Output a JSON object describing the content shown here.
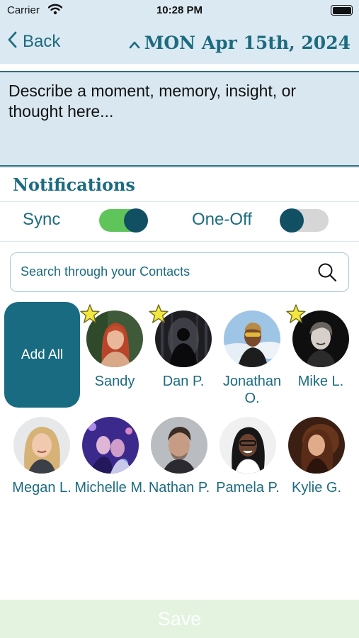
{
  "status_bar": {
    "carrier": "Carrier",
    "time": "10:28 PM",
    "battery_percent": 100
  },
  "nav": {
    "back_label": "Back",
    "date_label": "MON Apr 15th, 2024"
  },
  "note": {
    "placeholder": "Describe a moment, memory, insight, or thought here..."
  },
  "notifications": {
    "title": "Notifications",
    "sync_label": "Sync",
    "sync_on": true,
    "oneoff_label": "One-Off",
    "oneoff_on": false
  },
  "search": {
    "placeholder": "Search through your Contacts"
  },
  "add_all_label": "Add All",
  "contacts": [
    {
      "name": "Sandy",
      "starred": true
    },
    {
      "name": "Dan P.",
      "starred": true
    },
    {
      "name": "Jonathan O.",
      "starred": false
    },
    {
      "name": "Mike L.",
      "starred": true
    },
    {
      "name": "Megan L.",
      "starred": false
    },
    {
      "name": "Michelle M.",
      "starred": false
    },
    {
      "name": "Nathan P.",
      "starred": false
    },
    {
      "name": "Pamela P.",
      "starred": false
    },
    {
      "name": "Kylie G.",
      "starred": false
    }
  ],
  "save_label": "Save",
  "colors": {
    "accent": "#1c6b80",
    "toggle_on": "#5fc45a",
    "header_bg": "#dbe9f2",
    "save_bg": "#e3f3df",
    "star": "#f2e640"
  }
}
